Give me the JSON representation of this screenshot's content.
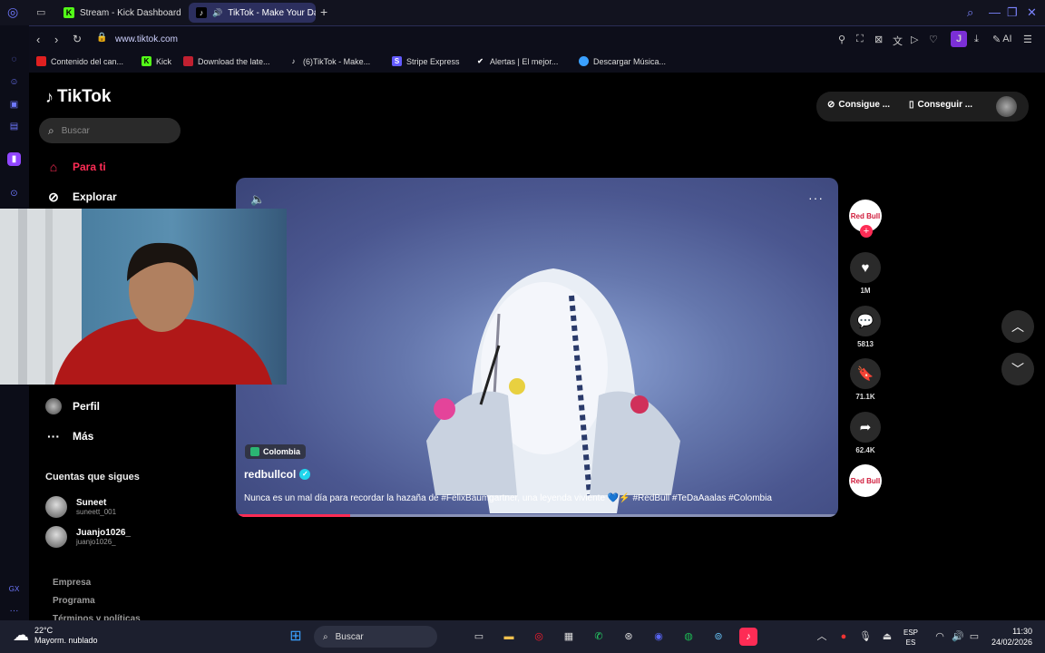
{
  "browser": {
    "tabs": [
      {
        "label": "Stream - Kick Dashboard",
        "icon": "kick-icon",
        "active": false
      },
      {
        "label": "TikTok - Make Your Da",
        "icon": "tiktok-icon",
        "active": true
      }
    ],
    "url": "www.tiktok.com",
    "profile_initial": "J",
    "ai_label": "AI",
    "bookmarks": [
      "Contenido del can...",
      "Kick",
      "Download the late...",
      "(6)TikTok - Make...",
      "Stripe Express",
      "Alertas | El mejor...",
      "Descargar Música..."
    ]
  },
  "tiktok": {
    "logo": "TikTok",
    "search_placeholder": "Buscar",
    "nav": [
      {
        "label": "Para ti",
        "icon": "home-icon",
        "active": true
      },
      {
        "label": "Explorar",
        "icon": "compass-icon",
        "active": false
      },
      {
        "label": "Perfil",
        "icon": "avatar-icon",
        "active": false
      },
      {
        "label": "Más",
        "icon": "more-icon",
        "active": false
      }
    ],
    "following_title": "Cuentas que sigues",
    "following": [
      {
        "name": "Suneet",
        "handle": "suneett_001"
      },
      {
        "name": "Juanjo1026_",
        "handle": "juanjo1026_"
      }
    ],
    "footer_links": [
      "Empresa",
      "Programa",
      "Términos y políticas"
    ],
    "top_buttons": [
      "Consigue ...",
      "Conseguir ..."
    ],
    "video": {
      "location": "Colombia",
      "author": "redbullcol",
      "caption": "Nunca es un mal día para recordar la hazaña de #FelixBaumgartner, una leyenda viviente 💙⚡ #RedBull #TeDaAaalas #Colombia",
      "progress": 0.19
    },
    "actions": {
      "avatar_label": "Red Bull",
      "likes": "1M",
      "comments": "5813",
      "saves": "71.1K",
      "shares": "62.4K"
    }
  },
  "taskbar": {
    "weather_temp": "22°C",
    "weather_desc": "Mayorm. nublado",
    "search_label": "Buscar",
    "lang_top": "ESP",
    "lang_bottom": "ES",
    "time": "11:30",
    "date": "24/02/2026"
  },
  "colors": {
    "accent": "#fe2c55",
    "browser_accent": "#7c84ff"
  }
}
